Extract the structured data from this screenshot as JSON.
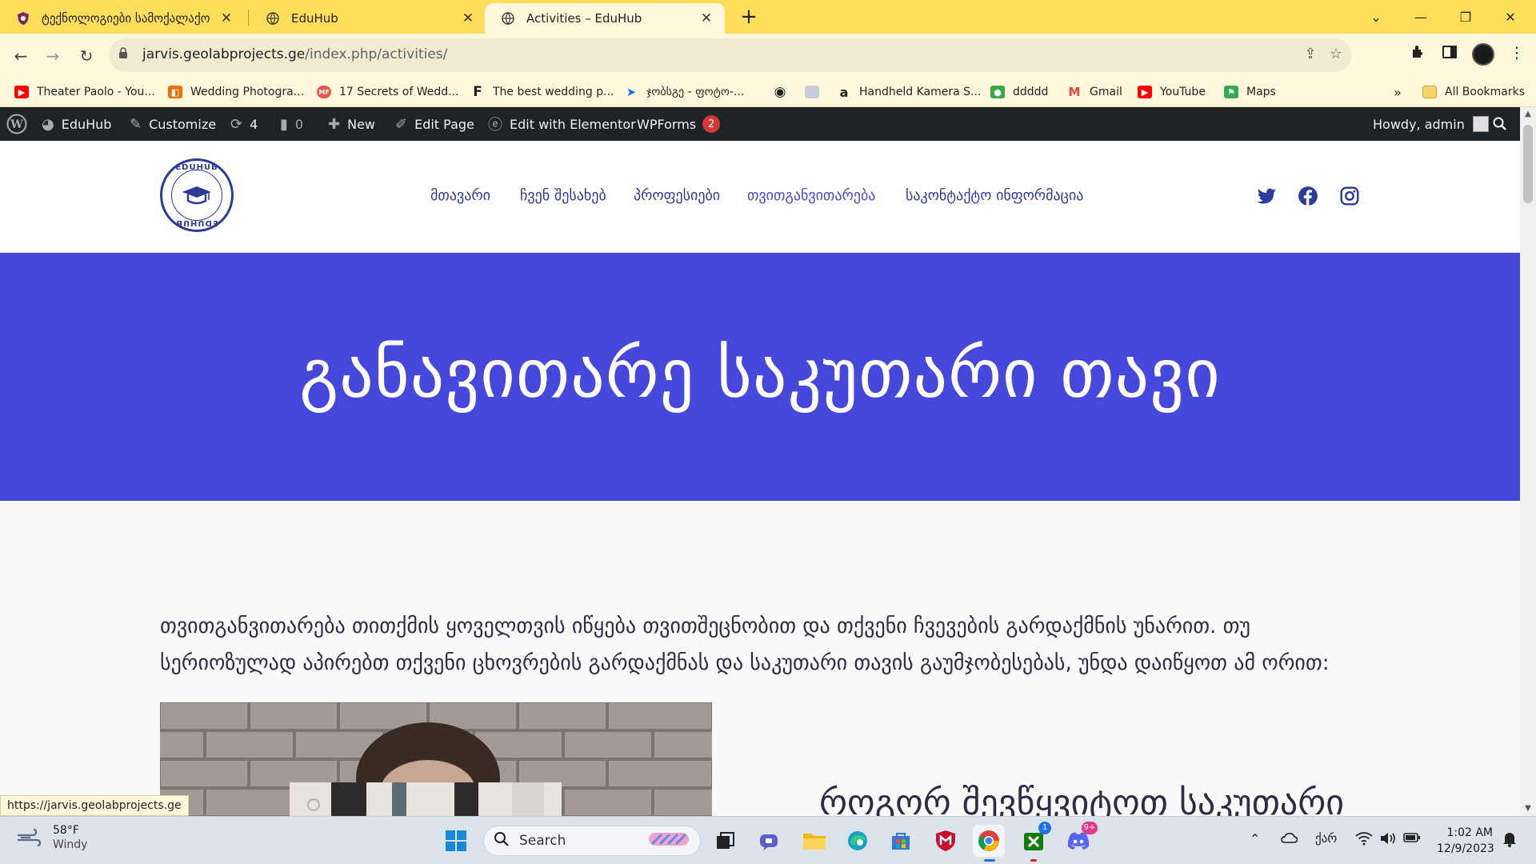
{
  "browser": {
    "tabs": [
      {
        "title": "ტექნოლოგიები სამოქალაქო"
      },
      {
        "title": "EduHub"
      },
      {
        "title": "Activities – EduHub"
      }
    ],
    "url_domain": "jarvis.geolabprojects.ge",
    "url_path": "/index.php/activities/",
    "bookmarks": [
      {
        "label": "Theater Paolo - You...",
        "icon": "youtube-icon",
        "color": "#ff0000"
      },
      {
        "label": "Wedding Photogra...",
        "icon": "orange-square-icon",
        "color": "#e8710a"
      },
      {
        "label": "17 Secrets of Wedd...",
        "icon": "mf-icon",
        "color": "#e8584a"
      },
      {
        "label": "The best wedding p...",
        "icon": "f-letter-icon",
        "color": "#222222"
      },
      {
        "label": "ჯობსგე - ფოტო-...",
        "icon": "plane-icon",
        "color": "#1a73e8"
      },
      {
        "label": "",
        "icon": "globe-icon",
        "color": "#222222"
      },
      {
        "label": "",
        "icon": "image-icon",
        "color": "#b0b8c4"
      },
      {
        "label": "Handheld Kamera S...",
        "icon": "amazon-icon",
        "color": "#222222"
      },
      {
        "label": "ddddd",
        "icon": "green-icon",
        "color": "#3aa845"
      },
      {
        "label": "Gmail",
        "icon": "gmail-icon",
        "color": "#ea4335"
      },
      {
        "label": "YouTube",
        "icon": "youtube-icon",
        "color": "#ff0000"
      },
      {
        "label": "Maps",
        "icon": "maps-icon",
        "color": "#34a853"
      }
    ],
    "bookmarks_more": "»",
    "all_bookmarks": "All Bookmarks",
    "status_url": "https://jarvis.geolabprojects.ge"
  },
  "adminbar": {
    "site_name": "EduHub",
    "customize": "Customize",
    "updates_count": "4",
    "comments_count": "0",
    "new_label": "New",
    "edit_page": "Edit Page",
    "elementor": "Edit with Elementor",
    "wpforms": "WPForms",
    "wpforms_badge": "2",
    "howdy": "Howdy, admin"
  },
  "site": {
    "logo_top": "EDUHUB",
    "logo_bottom": "EDUHUB",
    "nav": [
      {
        "label": "მთავარი"
      },
      {
        "label": "ჩვენ შესახებ"
      },
      {
        "label": "პროფესიები"
      },
      {
        "label": "თვითგანვითარება"
      },
      {
        "label": "საკონტაქტო ინფორმაცია"
      }
    ],
    "social": [
      "twitter-icon",
      "facebook-icon",
      "instagram-icon"
    ],
    "accent": "#4548da",
    "nav_color": "#2c3a9c"
  },
  "hero": {
    "title": "განავითარე საკუთარი თავი"
  },
  "content": {
    "intro": "თვითგანვითარება თითქმის ყოველთვის იწყება თვითშეცნობით და თქვენი ჩვევების გარდაქმნის უნარით. თუ სერიოზულად აპირებთ თქვენი ცხოვრების გარდაქმნას და საკუთარი თავის გაუმჯობესებას, უნდა დაიწყოთ ამ ორით:",
    "subheading": "როგორ შევწყვიტოთ საკუთარი"
  },
  "taskbar": {
    "temp": "58°F",
    "weather": "Windy",
    "search": "Search",
    "lang": "ქარ",
    "time": "1:02 AM",
    "date": "12/9/2023",
    "xbox_badge": "1",
    "discord_badge": "9+"
  }
}
